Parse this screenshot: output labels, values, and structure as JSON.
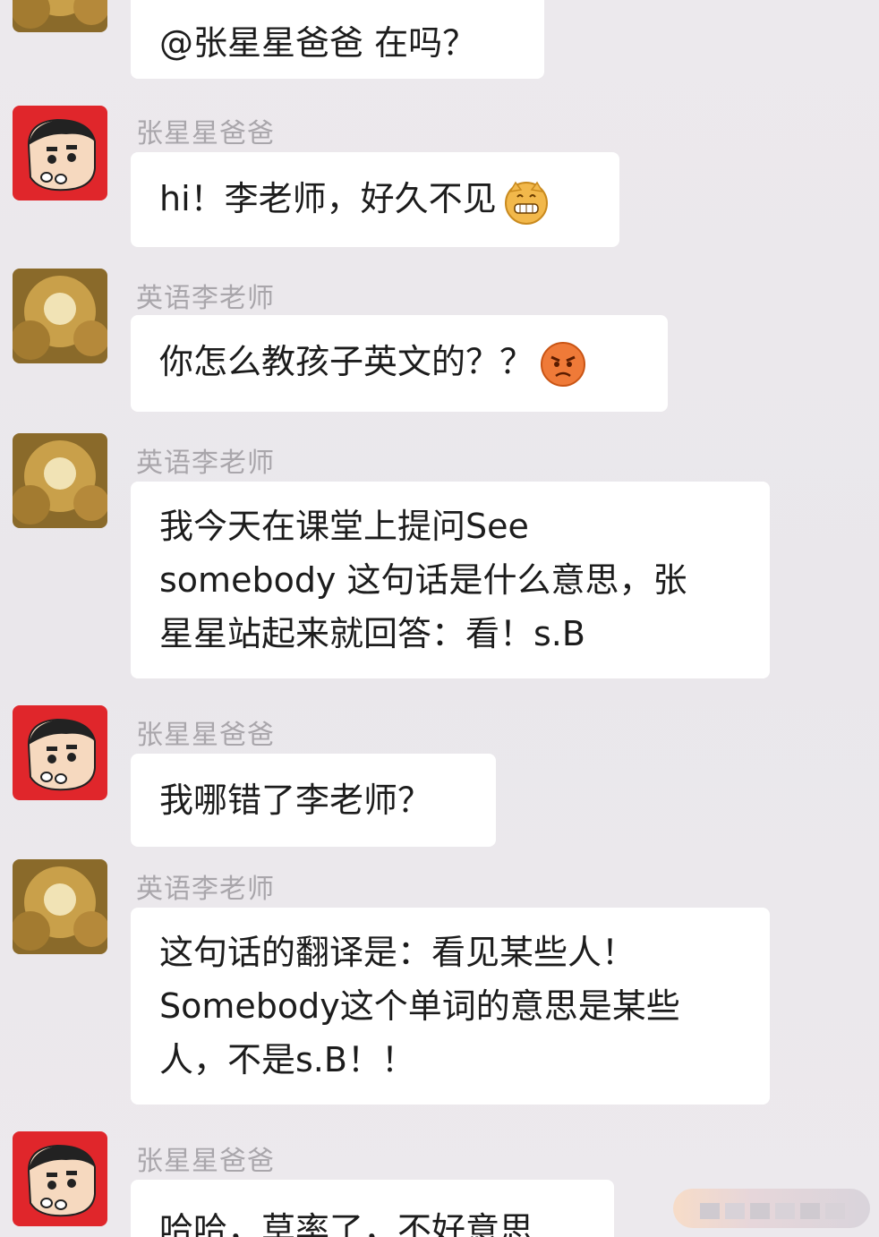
{
  "messages": [
    {
      "id": "m1",
      "sender": "",
      "avatar": "teacher-avatar",
      "text": "@张星星爸爸 在吗？",
      "emoji": ""
    },
    {
      "id": "m2",
      "sender": "张星星爸爸",
      "avatar": "crayon-shin-avatar",
      "text": "hi！李老师，好久不见",
      "emoji": "grin-emoji"
    },
    {
      "id": "m3",
      "sender": "英语李老师",
      "avatar": "teacher-avatar",
      "text": "你怎么教孩子英文的？？",
      "emoji": "angry-emoji"
    },
    {
      "id": "m4",
      "sender": "英语李老师",
      "avatar": "teacher-avatar",
      "text": "我今天在课堂上提问See\nsomebody 这句话是什么意思，张\n星星站起来就回答：看！s.B",
      "emoji": ""
    },
    {
      "id": "m5",
      "sender": "张星星爸爸",
      "avatar": "crayon-shin-avatar",
      "text": "我哪错了李老师？",
      "emoji": ""
    },
    {
      "id": "m6",
      "sender": "英语李老师",
      "avatar": "teacher-avatar",
      "text": "这句话的翻译是：看见某些人！\nSomebody这个单词的意思是某些\n人，不是s.B！！",
      "emoji": ""
    },
    {
      "id": "m7",
      "sender": "张星星爸爸",
      "avatar": "crayon-shin-avatar",
      "text": "哈哈，草率了，不好意思",
      "emoji": ""
    }
  ],
  "colors": {
    "background": "#ebe8ec",
    "bubble": "#ffffff",
    "sender_name": "#a9a6ab",
    "text": "#1c1c1c",
    "shin_avatar_bg": "#e0262b"
  }
}
